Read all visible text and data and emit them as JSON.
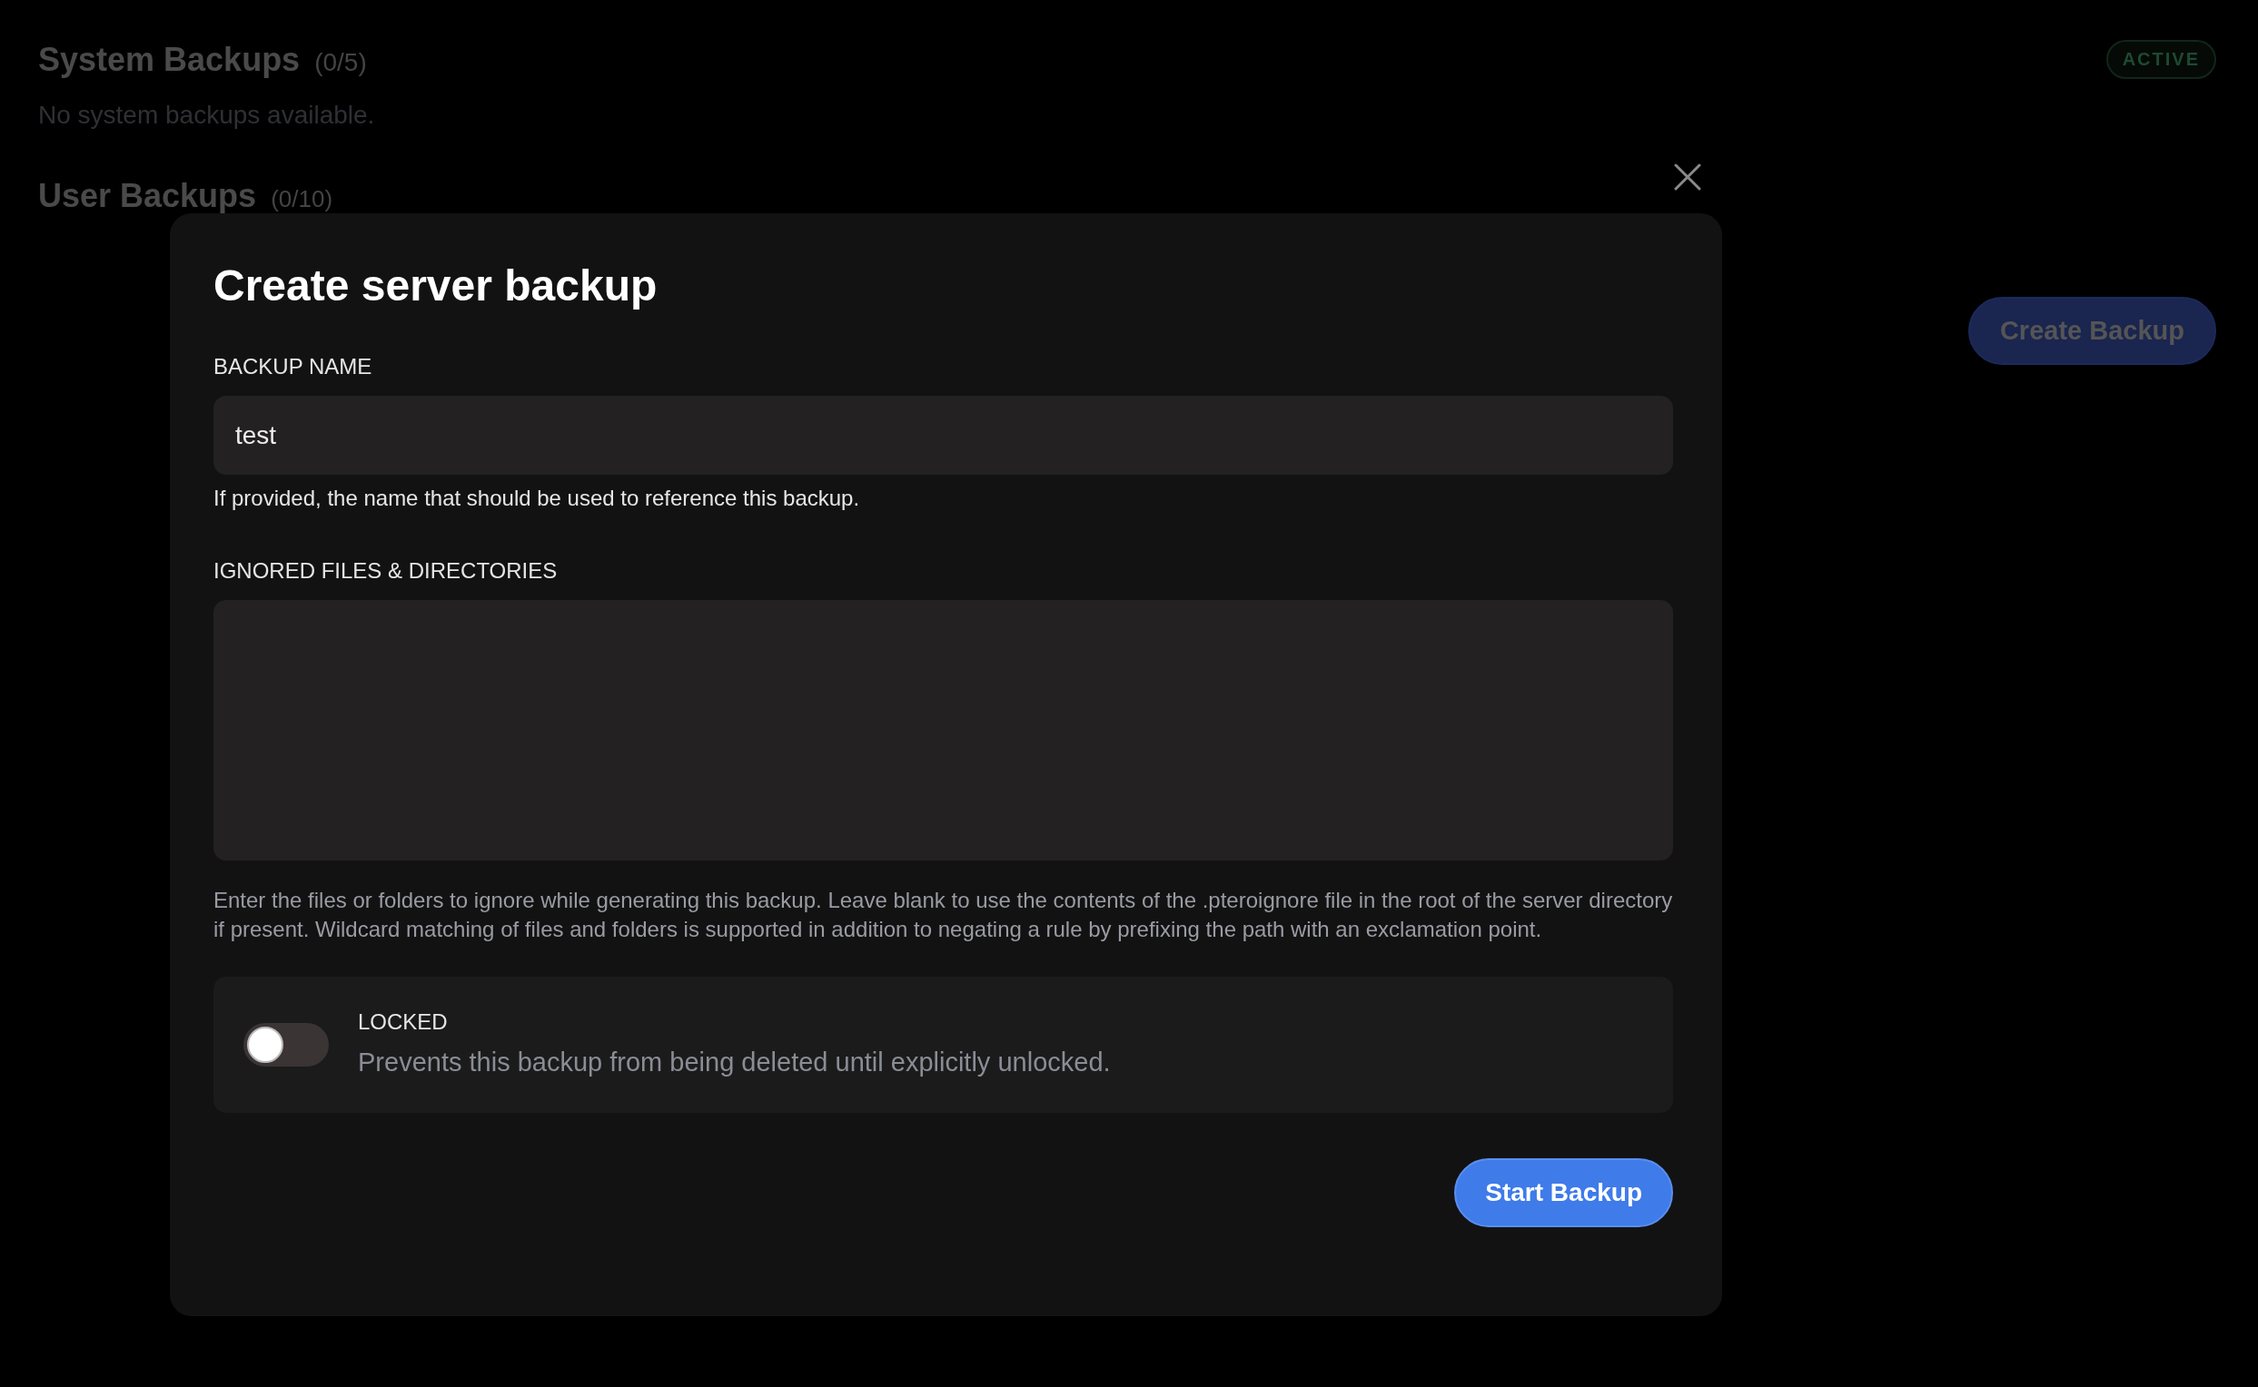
{
  "background": {
    "system_backups": {
      "title": "System Backups",
      "count": "(0/5)",
      "empty_text": "No system backups available.",
      "status_badge": "ACTIVE"
    },
    "user_backups": {
      "title": "User Backups",
      "count": "(0/10)"
    },
    "create_button": "Create Backup"
  },
  "modal": {
    "title": "Create server backup",
    "name_field": {
      "label": "BACKUP NAME",
      "value": "test",
      "help": "If provided, the name that should be used to reference this backup."
    },
    "ignored_field": {
      "label": "IGNORED FILES & DIRECTORIES",
      "help": "Enter the files or folders to ignore while generating this backup. Leave blank to use the contents of the .pteroignore file in the root of the server directory if present. Wildcard matching of files and folders is supported in addition to negating a rule by prefixing the path with an exclamation point."
    },
    "locked": {
      "label": "LOCKED",
      "description": "Prevents this backup from being deleted until explicitly unlocked.",
      "checked": false
    },
    "submit_button": "Start Backup"
  }
}
